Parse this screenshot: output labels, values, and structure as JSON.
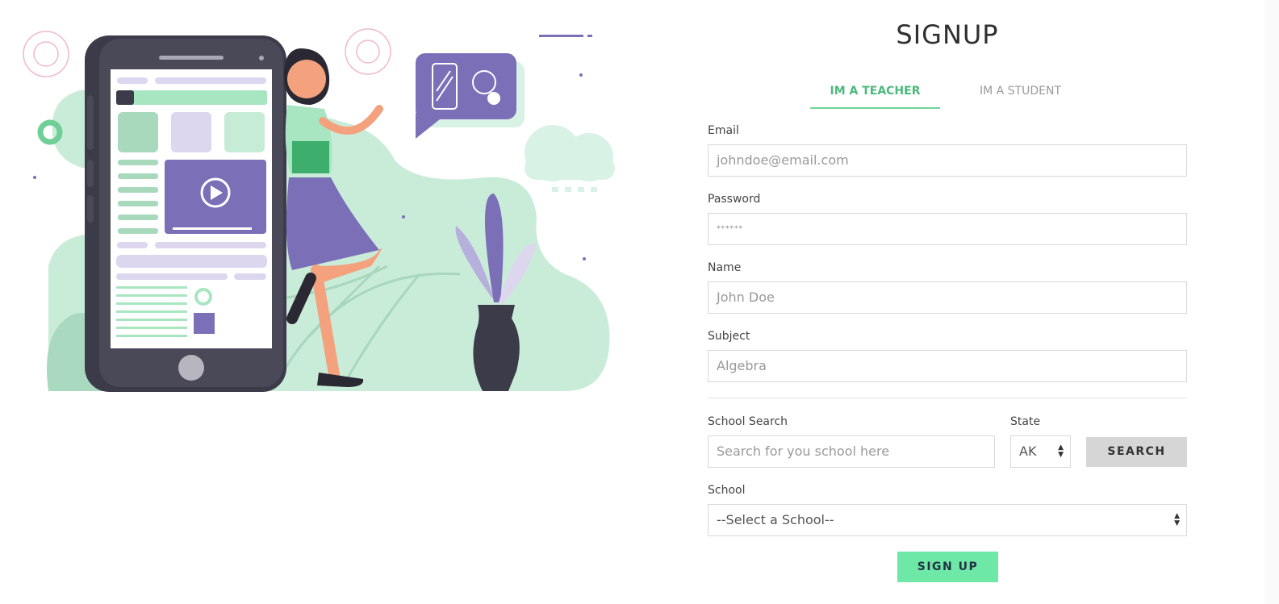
{
  "page": {
    "title": "SIGNUP"
  },
  "tabs": [
    {
      "label": "IM A TEACHER",
      "active": true
    },
    {
      "label": "IM A STUDENT",
      "active": false
    }
  ],
  "form": {
    "email": {
      "label": "Email",
      "placeholder": "johndoe@email.com"
    },
    "password": {
      "label": "Password",
      "placeholder": "******"
    },
    "name": {
      "label": "Name",
      "placeholder": "John Doe"
    },
    "subject": {
      "label": "Subject",
      "placeholder": "Algebra"
    },
    "school_search": {
      "label": "School Search",
      "placeholder": "Search for you school here"
    },
    "state": {
      "label": "State",
      "value": "AK"
    },
    "search_button": "SEARCH",
    "school": {
      "label": "School",
      "value": "--Select a School--"
    },
    "signup_button": "SIGN UP"
  },
  "colors": {
    "accent_green": "#6ee8a6",
    "tab_active": "#4cb97d",
    "illustration_purple": "#7b6fb8",
    "illustration_mint": "#c9ecd9"
  },
  "illustration": {
    "semantic": "person-with-phone-illustration"
  }
}
